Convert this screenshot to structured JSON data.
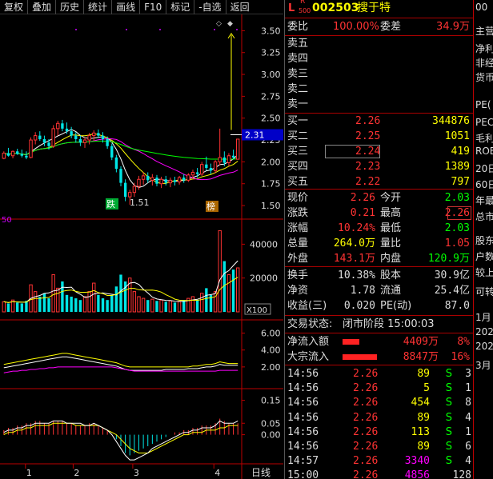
{
  "toolbar": {
    "items": [
      "复权",
      "叠加",
      "历史",
      "统计",
      "画线",
      "F10",
      "标记",
      "-自选",
      "返回"
    ]
  },
  "header": {
    "l_mark": "L",
    "r_mark": "R",
    "r_sub": "500",
    "code": "002503",
    "name": "搜于特"
  },
  "weibi": {
    "label": "委比",
    "value": "100.00%",
    "label2": "委差",
    "value2": "34.9万"
  },
  "sell": [
    {
      "label": "卖五",
      "price": "",
      "vol": ""
    },
    {
      "label": "卖四",
      "price": "",
      "vol": ""
    },
    {
      "label": "卖三",
      "price": "",
      "vol": ""
    },
    {
      "label": "卖二",
      "price": "",
      "vol": ""
    },
    {
      "label": "卖一",
      "price": "",
      "vol": ""
    }
  ],
  "buy": [
    {
      "label": "买一",
      "price": "2.26",
      "vol": "344876"
    },
    {
      "label": "买二",
      "price": "2.25",
      "vol": "1051"
    },
    {
      "label": "买三",
      "price": "2.24",
      "vol": "419"
    },
    {
      "label": "买四",
      "price": "2.23",
      "vol": "1389"
    },
    {
      "label": "买五",
      "price": "2.22",
      "vol": "797"
    }
  ],
  "stats": [
    {
      "l1": "现价",
      "v1": "2.26",
      "l2": "今开",
      "v2": "2.03"
    },
    {
      "l1": "涨跌",
      "v1": "0.21",
      "l2": "最高",
      "v2": "2.26"
    },
    {
      "l1": "涨幅",
      "v1": "10.24%",
      "l2": "最低",
      "v2": "2.03"
    },
    {
      "l1": "总量",
      "v1": "264.0万",
      "l2": "量比",
      "v2": "1.05"
    },
    {
      "l1": "外盘",
      "v1": "143.1万",
      "l2": "内盘",
      "v2": "120.9万"
    }
  ],
  "stats2": [
    {
      "l1": "换手",
      "v1": "10.38%",
      "l2": "股本",
      "v2": "30.9亿"
    },
    {
      "l1": "净资",
      "v1": "1.78",
      "l2": "流通",
      "v2": "25.4亿"
    },
    {
      "l1": "收益(三)",
      "v1": "0.020",
      "l2": "PE(动)",
      "v2": "87.0"
    }
  ],
  "status": {
    "label": "交易状态:",
    "value": "闭市阶段 15:00:03"
  },
  "flow": [
    {
      "label": "净流入额",
      "amount": "4409万",
      "pct": "8%",
      "bar": 0.37
    },
    {
      "label": "大宗流入",
      "amount": "8847万",
      "pct": "16%",
      "bar": 0.74
    }
  ],
  "ticks": [
    {
      "time": "14:56",
      "price": "2.26",
      "vol": "89",
      "side": "S",
      "n": "3"
    },
    {
      "time": "14:56",
      "price": "2.26",
      "vol": "5",
      "side": "S",
      "n": "1"
    },
    {
      "time": "14:56",
      "price": "2.26",
      "vol": "454",
      "side": "S",
      "n": "8"
    },
    {
      "time": "14:56",
      "price": "2.26",
      "vol": "89",
      "side": "S",
      "n": "4"
    },
    {
      "time": "14:56",
      "price": "2.26",
      "vol": "113",
      "side": "S",
      "n": "1"
    },
    {
      "time": "14:56",
      "price": "2.26",
      "vol": "89",
      "side": "S",
      "n": "6"
    },
    {
      "time": "14:57",
      "price": "2.26",
      "vol": "3340",
      "side": "S",
      "n": "4"
    },
    {
      "time": "15:00",
      "price": "2.26",
      "vol": "4856",
      "side": "",
      "n": "128"
    }
  ],
  "right_strip": [
    "00",
    "主营",
    "净利",
    "非经",
    "货币",
    "PE(",
    "PEC",
    "毛利",
    "ROE",
    "20日",
    "60日",
    "年最",
    "总市",
    "股东",
    "户数",
    "较上",
    "可转",
    "1月",
    "202",
    "202",
    "3月"
  ],
  "colors": {
    "up": "#ff3333",
    "down": "#00e5e5",
    "green": "#00ff00",
    "yellow": "#ffff00",
    "white": "#ffffff",
    "magenta": "#ff00ff",
    "blue": "#5a8cff"
  },
  "chart_data": [
    {
      "type": "candlestick",
      "panel": "price",
      "y_ticks": [
        "3.50",
        "3.25",
        "3.00",
        "2.75",
        "2.50",
        "2.25",
        "2.00",
        "1.75",
        "1.50"
      ],
      "ylim": [
        1.4,
        3.65
      ],
      "last_price_label": "2.31",
      "annotations": [
        "跌",
        "1.51",
        "榜"
      ],
      "ohlc": [
        [
          2.04,
          2.12,
          2.03,
          2.1
        ],
        [
          2.1,
          2.16,
          2.06,
          2.07
        ],
        [
          2.07,
          2.13,
          2.04,
          2.12
        ],
        [
          2.12,
          2.15,
          2.08,
          2.09
        ],
        [
          2.09,
          2.14,
          2.05,
          2.07
        ],
        [
          2.07,
          2.12,
          2.03,
          2.05
        ],
        [
          2.05,
          2.28,
          2.04,
          2.25
        ],
        [
          2.25,
          2.34,
          2.2,
          2.3
        ],
        [
          2.3,
          2.35,
          2.24,
          2.26
        ],
        [
          2.26,
          2.3,
          2.18,
          2.22
        ],
        [
          2.22,
          2.26,
          2.14,
          2.18
        ],
        [
          2.18,
          2.42,
          2.16,
          2.38
        ],
        [
          2.38,
          2.47,
          2.3,
          2.44
        ],
        [
          2.44,
          2.48,
          2.35,
          2.38
        ],
        [
          2.38,
          2.45,
          2.32,
          2.35
        ],
        [
          2.35,
          2.4,
          2.27,
          2.3
        ],
        [
          2.3,
          2.34,
          2.22,
          2.26
        ],
        [
          2.26,
          2.3,
          2.18,
          2.22
        ],
        [
          2.22,
          2.28,
          2.16,
          2.25
        ],
        [
          2.25,
          2.33,
          2.2,
          2.3
        ],
        [
          2.3,
          2.36,
          2.24,
          2.33
        ],
        [
          2.33,
          2.37,
          2.27,
          2.3
        ],
        [
          2.3,
          2.34,
          2.22,
          2.26
        ],
        [
          2.26,
          2.29,
          2.15,
          2.18
        ],
        [
          2.18,
          2.21,
          2.02,
          2.05
        ],
        [
          2.05,
          2.08,
          1.88,
          1.92
        ],
        [
          1.92,
          1.95,
          1.72,
          1.76
        ],
        [
          1.76,
          1.8,
          1.55,
          1.6
        ],
        [
          1.6,
          1.68,
          1.51,
          1.65
        ],
        [
          1.65,
          1.76,
          1.6,
          1.72
        ],
        [
          1.72,
          1.84,
          1.68,
          1.8
        ],
        [
          1.8,
          1.88,
          1.74,
          1.84
        ],
        [
          1.84,
          1.88,
          1.76,
          1.79
        ],
        [
          1.79,
          1.86,
          1.73,
          1.82
        ],
        [
          1.82,
          1.85,
          1.72,
          1.75
        ],
        [
          1.75,
          1.83,
          1.7,
          1.8
        ],
        [
          1.8,
          1.84,
          1.73,
          1.76
        ],
        [
          1.76,
          1.82,
          1.71,
          1.79
        ],
        [
          1.79,
          1.83,
          1.73,
          1.77
        ],
        [
          1.77,
          1.84,
          1.74,
          1.82
        ],
        [
          1.82,
          1.86,
          1.76,
          1.79
        ],
        [
          1.79,
          1.87,
          1.77,
          1.85
        ],
        [
          1.85,
          1.91,
          1.8,
          1.88
        ],
        [
          1.88,
          1.93,
          1.82,
          1.86
        ],
        [
          1.86,
          2.0,
          1.84,
          1.97
        ],
        [
          1.97,
          2.06,
          1.9,
          1.93
        ],
        [
          1.93,
          1.98,
          1.86,
          1.9
        ],
        [
          1.9,
          2.02,
          1.87,
          2.0
        ],
        [
          2.0,
          2.38,
          1.96,
          2.05
        ],
        [
          2.05,
          2.12,
          1.95,
          1.99
        ],
        [
          1.99,
          2.1,
          1.95,
          2.07
        ],
        [
          2.07,
          2.14,
          2.03,
          2.05
        ],
        [
          2.03,
          2.26,
          2.03,
          2.26
        ]
      ]
    },
    {
      "type": "bar",
      "panel": "volume",
      "label_left": "50",
      "y_ticks": [
        "40000",
        "20000"
      ],
      "unit": "X100",
      "ylim": [
        0,
        52000
      ],
      "values": [
        6000,
        5000,
        7000,
        5500,
        5000,
        6500,
        16000,
        12000,
        9000,
        11000,
        8000,
        22000,
        14000,
        18000,
        10000,
        9000,
        8000,
        7000,
        9000,
        12000,
        17000,
        10000,
        8000,
        7000,
        10000,
        15000,
        22000,
        18000,
        20000,
        12000,
        9000,
        8000,
        7000,
        7500,
        6500,
        7000,
        6000,
        6500,
        5500,
        6000,
        7000,
        8000,
        9000,
        7000,
        11000,
        14000,
        10000,
        12000,
        48000,
        30000,
        22000,
        25000,
        26000
      ]
    },
    {
      "type": "line",
      "panel": "indicator1",
      "y_ticks": [
        "6.00",
        "4.00",
        "2.00"
      ],
      "ylim": [
        0,
        7
      ],
      "series": [
        {
          "color": "yellow",
          "values": [
            2.3,
            2.4,
            2.5,
            2.6,
            2.7,
            2.8,
            2.9,
            3.0,
            3.1,
            3.2,
            3.3,
            3.4,
            3.5,
            3.6,
            3.6,
            3.5,
            3.4,
            3.3,
            3.2,
            3.1,
            3.0,
            2.9,
            2.8,
            2.7,
            2.6,
            2.5,
            2.3,
            2.1,
            2.0,
            2.0,
            2.0,
            2.0,
            2.0,
            2.0,
            2.0,
            2.0,
            2.0,
            2.0,
            2.0,
            2.0,
            2.0,
            2.0,
            2.1,
            2.1,
            2.2,
            2.3,
            2.3,
            2.4,
            2.6,
            2.5,
            2.4,
            2.4,
            2.4
          ]
        },
        {
          "color": "white",
          "values": [
            1.9,
            2.0,
            2.1,
            2.2,
            2.3,
            2.4,
            2.5,
            2.6,
            2.7,
            2.8,
            2.9,
            3.0,
            3.1,
            3.2,
            3.2,
            3.1,
            3.0,
            2.9,
            2.8,
            2.7,
            2.6,
            2.5,
            2.4,
            2.3,
            2.2,
            2.1,
            1.9,
            1.7,
            1.6,
            1.6,
            1.6,
            1.6,
            1.6,
            1.6,
            1.6,
            1.6,
            1.7,
            1.7,
            1.7,
            1.7,
            1.7,
            1.8,
            1.8,
            1.8,
            1.9,
            2.0,
            2.0,
            2.1,
            2.3,
            2.2,
            2.2,
            2.2,
            2.2
          ]
        },
        {
          "color": "magenta",
          "values": [
            1.3,
            1.4,
            1.5,
            1.5,
            1.6,
            1.6,
            1.7,
            1.7,
            1.8,
            1.8,
            1.9,
            1.9,
            2.0,
            2.0,
            2.0,
            2.0,
            2.0,
            2.0,
            2.0,
            2.0,
            2.0,
            2.0,
            2.0,
            2.0,
            2.0,
            1.9,
            1.8,
            1.7,
            1.6,
            1.5,
            1.5,
            1.5,
            1.5,
            1.5,
            1.5,
            1.5,
            1.5,
            1.5,
            1.5,
            1.5,
            1.5,
            1.5,
            1.5,
            1.5,
            1.5,
            1.5,
            1.5,
            1.5,
            1.6,
            1.6,
            1.6,
            1.6,
            1.6
          ]
        }
      ]
    },
    {
      "type": "bar",
      "panel": "macd",
      "y_ticks": [
        "0.15",
        "0.05",
        "0.00"
      ],
      "ylim": [
        -0.12,
        0.18
      ],
      "values": [
        0.02,
        0.03,
        0.03,
        0.04,
        0.04,
        0.05,
        0.05,
        0.06,
        0.06,
        0.05,
        0.05,
        0.06,
        0.06,
        0.06,
        0.05,
        0.05,
        0.04,
        0.04,
        0.04,
        0.05,
        0.05,
        0.04,
        0.03,
        0.02,
        0.0,
        -0.02,
        -0.05,
        -0.08,
        -0.09,
        -0.08,
        -0.07,
        -0.06,
        -0.05,
        -0.04,
        -0.03,
        -0.02,
        -0.01,
        0.0,
        0.01,
        0.01,
        0.02,
        0.02,
        0.03,
        0.03,
        0.04,
        0.04,
        0.04,
        0.05,
        0.07,
        0.06,
        0.05,
        0.05,
        0.05
      ],
      "series": [
        {
          "color": "yellow",
          "values": [
            0.0,
            0.01,
            0.01,
            0.02,
            0.02,
            0.03,
            0.03,
            0.04,
            0.04,
            0.04,
            0.04,
            0.05,
            0.05,
            0.05,
            0.05,
            0.05,
            0.04,
            0.04,
            0.04,
            0.04,
            0.04,
            0.04,
            0.03,
            0.02,
            0.01,
            0.0,
            -0.02,
            -0.04,
            -0.06,
            -0.07,
            -0.08,
            -0.08,
            -0.08,
            -0.07,
            -0.06,
            -0.05,
            -0.04,
            -0.03,
            -0.02,
            -0.01,
            0.0,
            0.0,
            0.01,
            0.01,
            0.01,
            0.02,
            0.02,
            0.02,
            0.03,
            0.03,
            0.04,
            0.04,
            0.04
          ]
        },
        {
          "color": "white",
          "values": [
            0.01,
            0.02,
            0.02,
            0.03,
            0.03,
            0.04,
            0.04,
            0.05,
            0.05,
            0.05,
            0.05,
            0.06,
            0.06,
            0.06,
            0.05,
            0.05,
            0.05,
            0.05,
            0.04,
            0.04,
            0.05,
            0.04,
            0.03,
            0.02,
            0.0,
            -0.03,
            -0.06,
            -0.09,
            -0.11,
            -0.11,
            -0.1,
            -0.09,
            -0.08,
            -0.06,
            -0.05,
            -0.04,
            -0.03,
            -0.02,
            -0.01,
            0.0,
            0.01,
            0.01,
            0.02,
            0.02,
            0.03,
            0.03,
            0.03,
            0.04,
            0.06,
            0.05,
            0.05,
            0.05,
            0.06
          ]
        }
      ]
    }
  ],
  "x_axis": {
    "labels": [
      "1",
      "2",
      "3",
      "4"
    ],
    "label_positions": [
      0.1,
      0.3,
      0.55,
      0.89
    ],
    "right_label": "日线"
  }
}
